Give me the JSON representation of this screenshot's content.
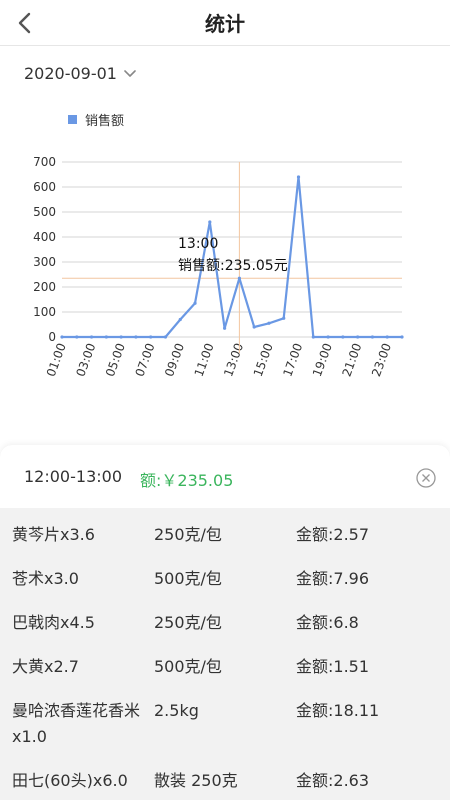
{
  "header": {
    "title": "统计"
  },
  "date_picker": {
    "value": "2020-09-01"
  },
  "legend": {
    "label": "销售额",
    "color": "#6a98e4"
  },
  "tooltip": {
    "time": "13:00",
    "text": "销售额:235.05元"
  },
  "chart_data": {
    "type": "line",
    "series": [
      {
        "name": "销售额",
        "x": [
          "01:00",
          "02:00",
          "03:00",
          "04:00",
          "05:00",
          "06:00",
          "07:00",
          "08:00",
          "09:00",
          "10:00",
          "11:00",
          "12:00",
          "13:00",
          "14:00",
          "15:00",
          "16:00",
          "17:00",
          "18:00",
          "19:00",
          "20:00",
          "21:00",
          "22:00",
          "23:00",
          "24:00"
        ],
        "values": [
          0,
          0,
          0,
          0,
          0,
          0,
          0,
          0,
          70,
          135,
          460,
          35,
          235.05,
          40,
          55,
          75,
          640,
          0,
          0,
          0,
          0,
          0,
          0,
          0
        ]
      }
    ],
    "x_tick_labels": [
      "01:00",
      "03:00",
      "05:00",
      "07:00",
      "09:00",
      "11:00",
      "13:00",
      "15:00",
      "17:00",
      "19:00",
      "21:00",
      "23:00"
    ],
    "y_ticks": [
      0,
      100,
      200,
      300,
      400,
      500,
      600,
      700
    ],
    "ylim": [
      0,
      700
    ],
    "highlight_index": 12,
    "grid": true,
    "legend_position": "top-left"
  },
  "detail": {
    "range": "12:00-13:00",
    "amount": "额:￥235.05",
    "items": [
      {
        "name": "黄芩片x3.6",
        "spec": "250克/包",
        "amount": "金额:2.57"
      },
      {
        "name": "苍术x3.0",
        "spec": "500克/包",
        "amount": "金额:7.96"
      },
      {
        "name": "巴戟肉x4.5",
        "spec": "250克/包",
        "amount": "金额:6.8"
      },
      {
        "name": "大黄x2.7",
        "spec": "500克/包",
        "amount": "金额:1.51"
      },
      {
        "name": "曼哈浓香莲花香米x1.0",
        "spec": "2.5kg",
        "amount": "金额:18.11"
      },
      {
        "name": "田七(60头)x6.0",
        "spec": "散装 250克",
        "amount": "金额:2.63"
      }
    ]
  },
  "colors": {
    "line": "#6a98e4",
    "crosshair": "#f2c6a0",
    "green": "#3bb55d",
    "grid": "#d6d6d6"
  }
}
